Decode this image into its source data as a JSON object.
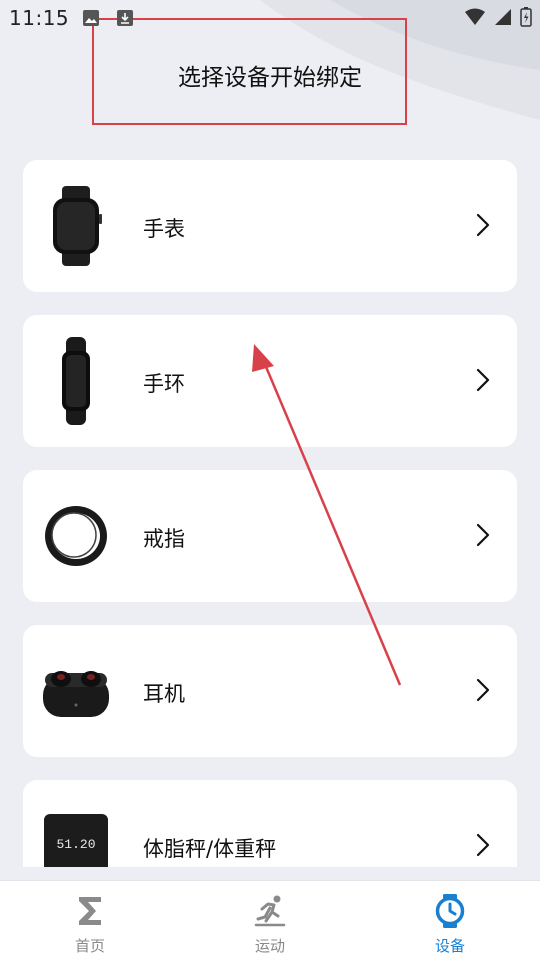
{
  "status_bar": {
    "time": "11:15"
  },
  "header": {
    "title": "选择设备开始绑定"
  },
  "devices": [
    {
      "label": "手表",
      "icon": "watch-icon"
    },
    {
      "label": "手环",
      "icon": "band-icon"
    },
    {
      "label": "戒指",
      "icon": "ring-icon"
    },
    {
      "label": "耳机",
      "icon": "earbuds-icon"
    },
    {
      "label": "体脂秤/体重秤",
      "icon": "scale-icon",
      "scale_reading": "51.20"
    }
  ],
  "tabbar": {
    "tabs": [
      {
        "label": "首页",
        "icon": "sigma-icon",
        "active": false
      },
      {
        "label": "运动",
        "icon": "running-icon",
        "active": false
      },
      {
        "label": "设备",
        "icon": "watch-icon",
        "active": true
      }
    ]
  },
  "colors": {
    "accent": "#1a7fd0",
    "annotation_red": "#d9414a",
    "background": "#eceef3",
    "card": "#ffffff"
  }
}
